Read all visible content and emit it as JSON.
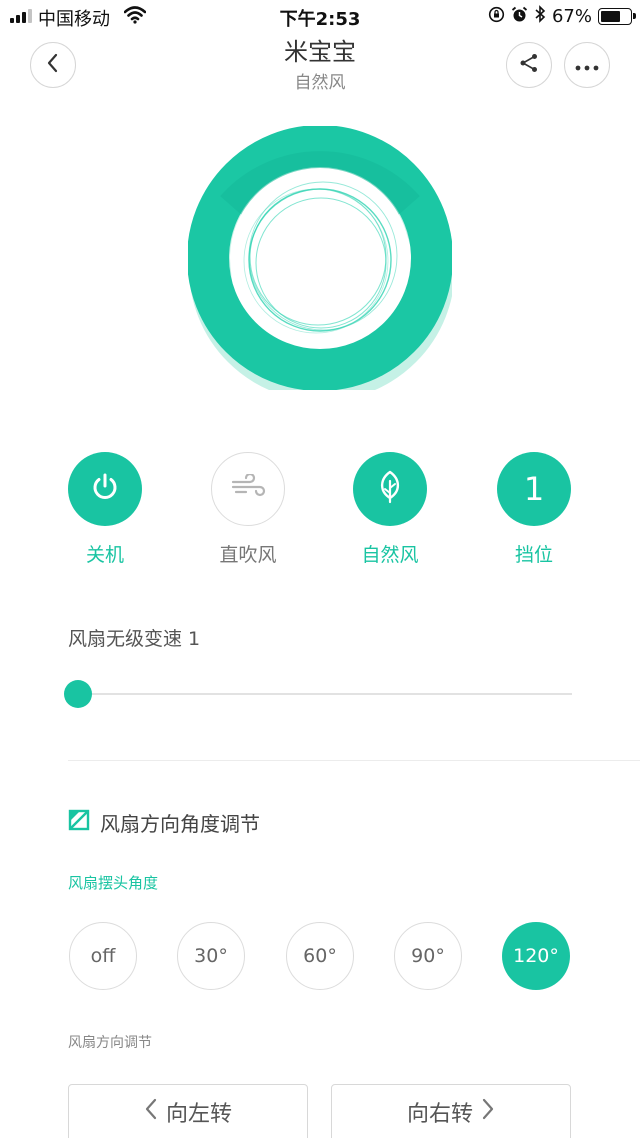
{
  "status_bar": {
    "carrier": "中国移动",
    "time": "下午2:53",
    "battery_percent": "67%",
    "battery_level": 0.67,
    "icons": [
      "signal-icon",
      "wifi-icon",
      "rotation-lock-icon",
      "alarm-icon",
      "bluetooth-icon",
      "battery-icon"
    ]
  },
  "header": {
    "title": "米宝宝",
    "subtitle": "自然风",
    "back_icon": "chevron-left-icon",
    "share_icon": "share-icon",
    "more_icon": "more-icon"
  },
  "modes": [
    {
      "label": "关机",
      "icon": "power-icon",
      "active": true
    },
    {
      "label": "直吹风",
      "icon": "wind-icon",
      "active": false
    },
    {
      "label": "自然风",
      "icon": "leaf-icon",
      "active": true
    },
    {
      "label": "挡位",
      "value": "1",
      "active": true
    }
  ],
  "speed": {
    "label": "风扇无级变速 1",
    "value": 1,
    "range": [
      1,
      100
    ]
  },
  "direction": {
    "section_title": "风扇方向角度调节",
    "angle_label": "风扇摆头角度",
    "angles": [
      {
        "label": "off",
        "selected": false
      },
      {
        "label": "30°",
        "selected": false
      },
      {
        "label": "60°",
        "selected": false
      },
      {
        "label": "90°",
        "selected": false
      },
      {
        "label": "120°",
        "selected": true
      }
    ],
    "dir_label": "风扇方向调节",
    "left_button": "向左转",
    "right_button": "向右转"
  },
  "colors": {
    "accent": "#19c4a2",
    "ring_dark": "#14b596",
    "ring_light": "#2fd3b3"
  }
}
